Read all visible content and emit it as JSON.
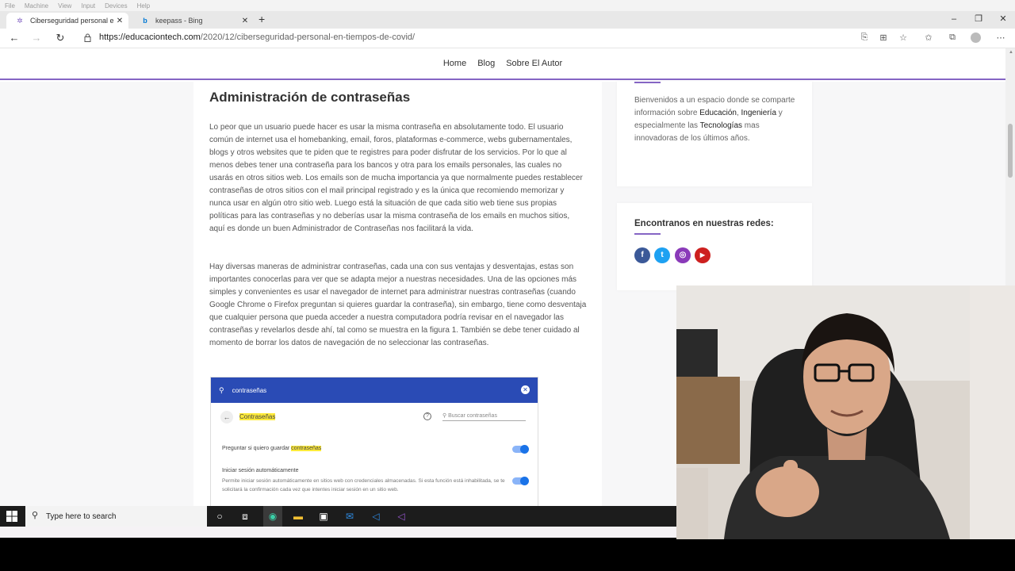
{
  "vm_menu": [
    "File",
    "Machine",
    "View",
    "Input",
    "Devices",
    "Help"
  ],
  "tabs": [
    {
      "label": "Ciberseguridad personal en tiem",
      "close": "✕"
    },
    {
      "label": "keepass - Bing",
      "close": "✕"
    }
  ],
  "new_tab": "+",
  "window_controls": {
    "minimize": "–",
    "maximize": "❐",
    "close": "✕"
  },
  "address": {
    "host": "https://educaciontech.com",
    "path": "/2020/12/ciberseguridad-personal-en-tiempos-de-covid/"
  },
  "site_nav": [
    "Home",
    "Blog",
    "Sobre El Autor"
  ],
  "article": {
    "heading": "Administración de contraseñas",
    "p1": "Lo peor que un usuario puede hacer es usar la misma contraseña en absolutamente todo. El usuario común de internet usa el homebanking, email, foros, plataformas e-commerce, webs gubernamentales, blogs y otros websites que te piden que te registres para poder disfrutar de los servicios. Por lo que al menos debes tener una contraseña para los bancos y otra para los emails personales, las cuales no usarás en otros sitios web. Los emails son de mucha importancia ya que normalmente puedes restablecer contraseñas de otros sitios con el mail principal registrado y es la única que recomiendo memorizar y nunca usar en algún otro sitio web. Luego está la situación de que cada sitio web tiene sus propias políticas para las contraseñas y no deberías usar la misma contraseña de los emails en muchos sitios, aquí es donde un buen Administrador de Contraseñas nos facilitará la vida.",
    "p2": "Hay diversas maneras de administrar contraseñas, cada una con sus ventajas y desventajas, estas son importantes conocerlas para ver que se adapta mejor a nuestras necesidades. Una de las opciones más simples y convenientes es usar el navegador de internet para administrar nuestras contraseñas (cuando Google Chrome o Firefox preguntan si quieres guardar la contraseña), sin embargo, tiene como desventaja que cualquier persona que pueda acceder a nuestra computadora podría revisar en el navegador las contraseñas y revelarlos desde ahí, tal como se muestra en la figura 1. También se debe tener cuidado al momento de borrar los datos de navegación de no seleccionar las contraseñas."
  },
  "figure": {
    "search_value": "contraseñas",
    "title": "Contraseñas",
    "search_placeholder": "Buscar contraseñas",
    "row1_prefix": "Preguntar si quiero guardar ",
    "row1_highlight": "contraseñas",
    "row2_title": "Iniciar sesión automáticamente",
    "row2_desc": "Permite iniciar sesión automáticamente en sitios web con credenciales almacenadas. Si esta función está inhabilitada, se te solicitará la confirmación cada vez que intentes iniciar sesión en un sitio web."
  },
  "sidebar": {
    "intro_a": "Bienvenidos a un espacio donde se comparte información sobre ",
    "intro_b1": "Educación",
    "intro_b2": "Ingeniería",
    "intro_c": " y especialmente las ",
    "intro_b3": "Tecnologías",
    "intro_d": " mas innovadoras de los últimos años.",
    "social_title": "Encontranos en nuestras redes:",
    "social": [
      {
        "name": "facebook",
        "glyph": "f",
        "color": "#3b5998"
      },
      {
        "name": "twitter",
        "glyph": "t",
        "color": "#1da1f2"
      },
      {
        "name": "instagram",
        "glyph": "◎",
        "color": "#8a3ab9"
      },
      {
        "name": "youtube",
        "glyph": "▶",
        "color": "#cd201f"
      }
    ]
  },
  "taskbar": {
    "search_placeholder": "Type here to search"
  }
}
